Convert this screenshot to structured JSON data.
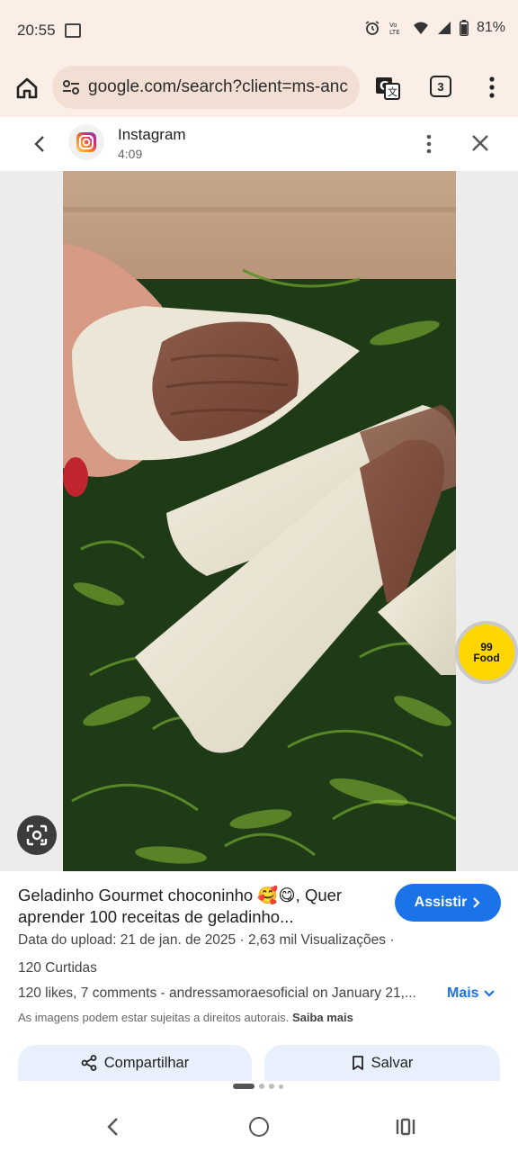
{
  "status_bar": {
    "time": "20:55",
    "battery": "81%",
    "icons": [
      "alarm-icon",
      "volte-icon",
      "wifi-icon",
      "signal-icon",
      "battery-icon"
    ]
  },
  "browser": {
    "url": "google.com/search?client=ms-anc",
    "tab_count": "3"
  },
  "viewer": {
    "source_name": "Instagram",
    "source_time": "4:09"
  },
  "image": {
    "badge_line1": "99",
    "badge_line2": "Food"
  },
  "result": {
    "title": "Geladinho Gourmet choconinho 🥰😋, Quer aprender 100 receitas de geladinho...",
    "visit_label": "Assistir",
    "meta_upload": "Data do upload: 21 de jan. de 2025",
    "meta_views": "2,63 mil Visualizações",
    "meta_likes": "120 Curtidas",
    "description": "120 likes, 7 comments - andressamoraesoficial on January 21,...",
    "more_label": "Mais",
    "copyright": "As imagens podem estar sujeitas a direitos autorais.",
    "learn_more": "Saiba mais",
    "share_label": "Compartilhar",
    "save_label": "Salvar"
  },
  "colors": {
    "accent": "#1a73e8",
    "browser_bar": "#fbeee6",
    "badge_yellow": "#ffd600"
  }
}
